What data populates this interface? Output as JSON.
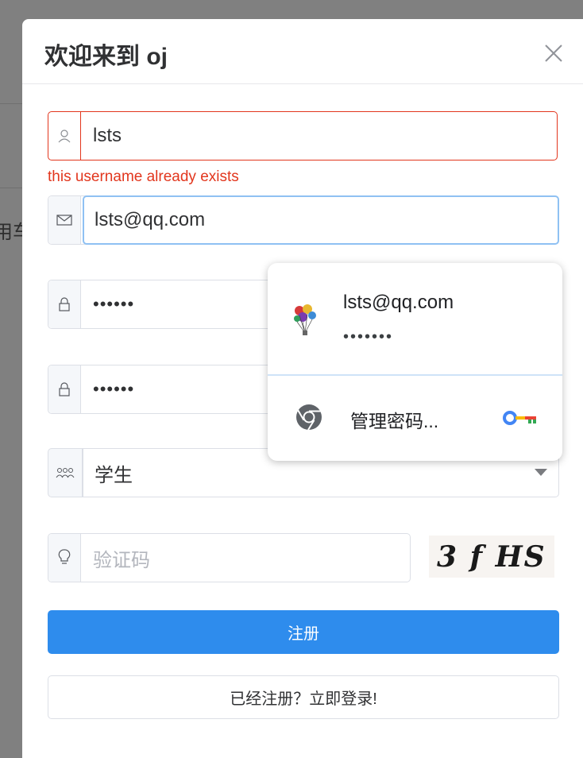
{
  "background": {
    "partial_text": "用车"
  },
  "dialog": {
    "title": "欢迎来到 oj",
    "close_label": "×"
  },
  "form": {
    "username": {
      "value": "lsts",
      "icon": "user-icon",
      "error": "this username already exists"
    },
    "email": {
      "value": "lsts@qq.com",
      "icon": "mail-icon"
    },
    "password": {
      "value": "••••••",
      "icon": "lock-icon"
    },
    "confirm_password": {
      "value": "••••••",
      "icon": "lock-icon"
    },
    "role": {
      "selected": "学生",
      "icon": "users-icon"
    },
    "captcha": {
      "placeholder": "验证码",
      "icon": "lightbulb-icon",
      "image_text": "3 f HS"
    },
    "register_label": "注册",
    "login_label": "已经注册？立即登录!"
  },
  "autofill": {
    "username": "lsts@qq.com",
    "password_mask": "•••••••",
    "manage_label": "管理密码...",
    "colors": {
      "divider": "#cfe3f8"
    }
  },
  "colors": {
    "primary": "#2e8ced",
    "error": "#e2361d",
    "focus": "#8fc1f3"
  }
}
